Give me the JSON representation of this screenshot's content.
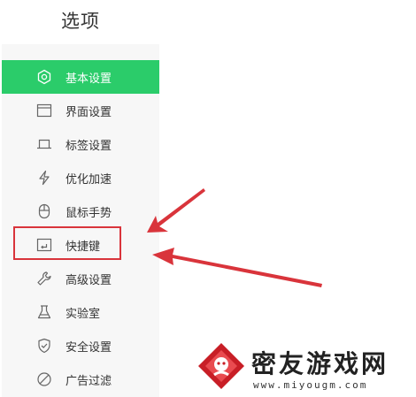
{
  "page_title": "选项",
  "sidebar": {
    "items": [
      {
        "label": "基本设置",
        "icon": "gear-icon",
        "active": true
      },
      {
        "label": "界面设置",
        "icon": "window-icon"
      },
      {
        "label": "标签设置",
        "icon": "tab-icon"
      },
      {
        "label": "优化加速",
        "icon": "lightning-icon"
      },
      {
        "label": "鼠标手势",
        "icon": "mouse-icon"
      },
      {
        "label": "快捷键",
        "icon": "keyboard-shortcut-icon",
        "highlighted": true
      },
      {
        "label": "高级设置",
        "icon": "wrench-icon"
      },
      {
        "label": "实验室",
        "icon": "flask-icon"
      },
      {
        "label": "安全设置",
        "icon": "shield-icon"
      },
      {
        "label": "广告过滤",
        "icon": "block-icon"
      }
    ]
  },
  "watermark": {
    "title": "密友游戏网",
    "url": "www.miyougm.com"
  },
  "colors": {
    "accent": "#2bcc6a",
    "annotation_red": "#d9343b",
    "sidebar_bg": "#f7f7f7"
  }
}
